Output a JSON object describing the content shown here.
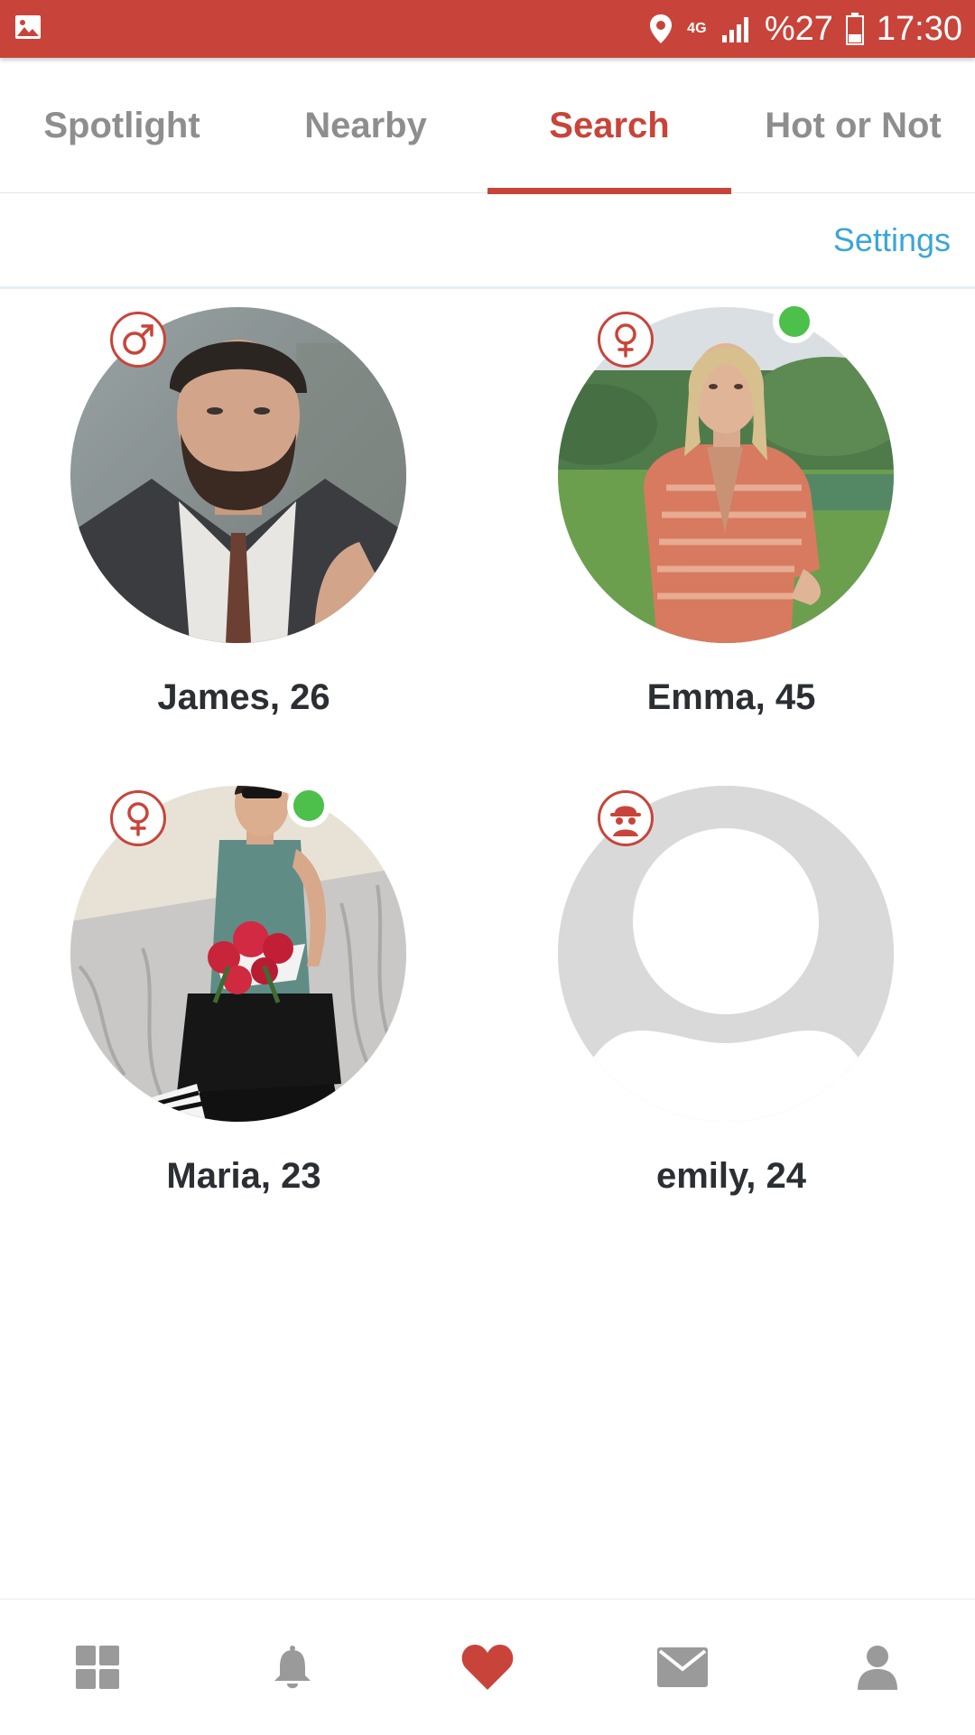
{
  "status_bar": {
    "network": "4G",
    "battery": "%27",
    "time": "17:30",
    "icons": [
      "gallery-icon",
      "location-icon",
      "signal-icon",
      "battery-icon"
    ]
  },
  "tabs": [
    {
      "label": "Spotlight",
      "active": false
    },
    {
      "label": "Nearby",
      "active": false
    },
    {
      "label": "Search",
      "active": true
    },
    {
      "label": "Hot or Not",
      "active": false
    }
  ],
  "settings_label": "Settings",
  "profiles": [
    {
      "name": "James, 26",
      "gender_icon": "male-icon",
      "online": false
    },
    {
      "name": "Emma, 45",
      "gender_icon": "female-icon",
      "online": true
    },
    {
      "name": "Maria, 23",
      "gender_icon": "female-icon",
      "online": true
    },
    {
      "name": "emily, 24",
      "gender_icon": "anonymous-icon",
      "online": false
    }
  ],
  "bottom_nav": [
    {
      "icon": "grid-icon",
      "active": false
    },
    {
      "icon": "bell-icon",
      "active": false
    },
    {
      "icon": "heart-icon",
      "active": true
    },
    {
      "icon": "mail-icon",
      "active": false
    },
    {
      "icon": "profile-icon",
      "active": false
    }
  ],
  "colors": {
    "brand": "#c8443a",
    "link": "#3aa6d6",
    "online": "#4cc04a",
    "inactive_icon": "#9a9a9a"
  }
}
